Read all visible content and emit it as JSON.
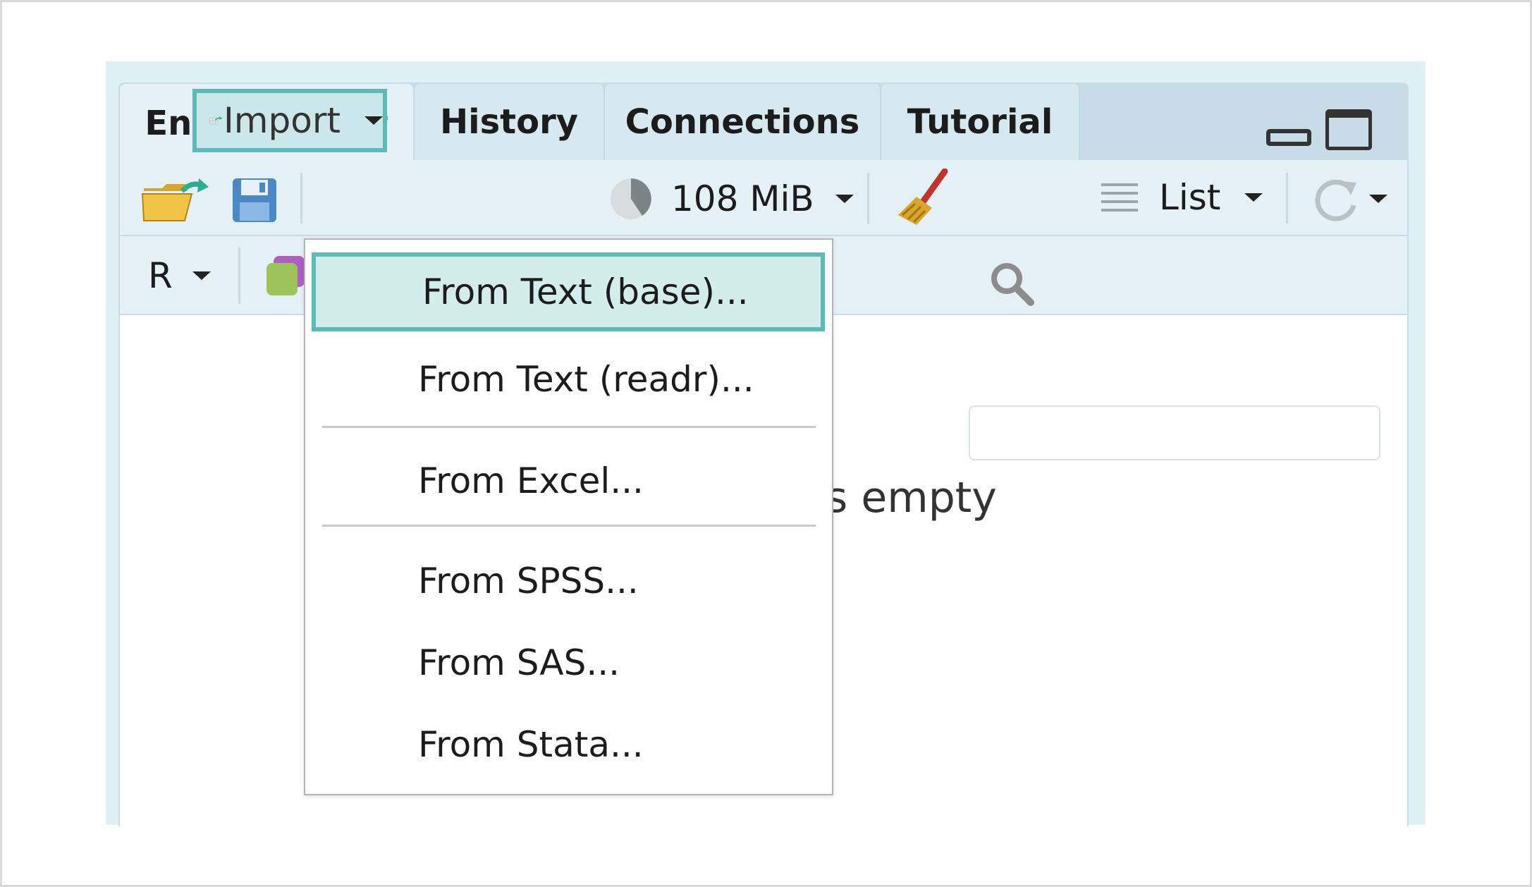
{
  "tabs": [
    {
      "label": "Environment",
      "active": true
    },
    {
      "label": "History",
      "active": false
    },
    {
      "label": "Connections",
      "active": false
    },
    {
      "label": "Tutorial",
      "active": false
    }
  ],
  "toolbar": {
    "open_icon": "folder-open-icon",
    "save_icon": "save-icon",
    "import_label": "Import",
    "memory_label": "108 MiB",
    "broom_icon": "broom-icon",
    "view_label": "List",
    "refresh_icon": "refresh-icon"
  },
  "toolbar2": {
    "language_label": "R",
    "search_placeholder": ""
  },
  "empty_message": "Environment is empty",
  "import_menu": {
    "items": [
      {
        "label": "From Text (base)...",
        "highlighted": true
      },
      {
        "label": "From Text (readr)...",
        "highlighted": false
      },
      {
        "label": "From Excel...",
        "highlighted": false
      },
      {
        "label": "From SPSS...",
        "highlighted": false
      },
      {
        "label": "From SAS...",
        "highlighted": false
      },
      {
        "label": "From Stata...",
        "highlighted": false
      }
    ]
  },
  "colors": {
    "accent": "#5cbbb6",
    "highlight_fill": "#d3ecec",
    "pane_background": "#e4f2f8",
    "tabbar_background": "#c6dde8"
  }
}
